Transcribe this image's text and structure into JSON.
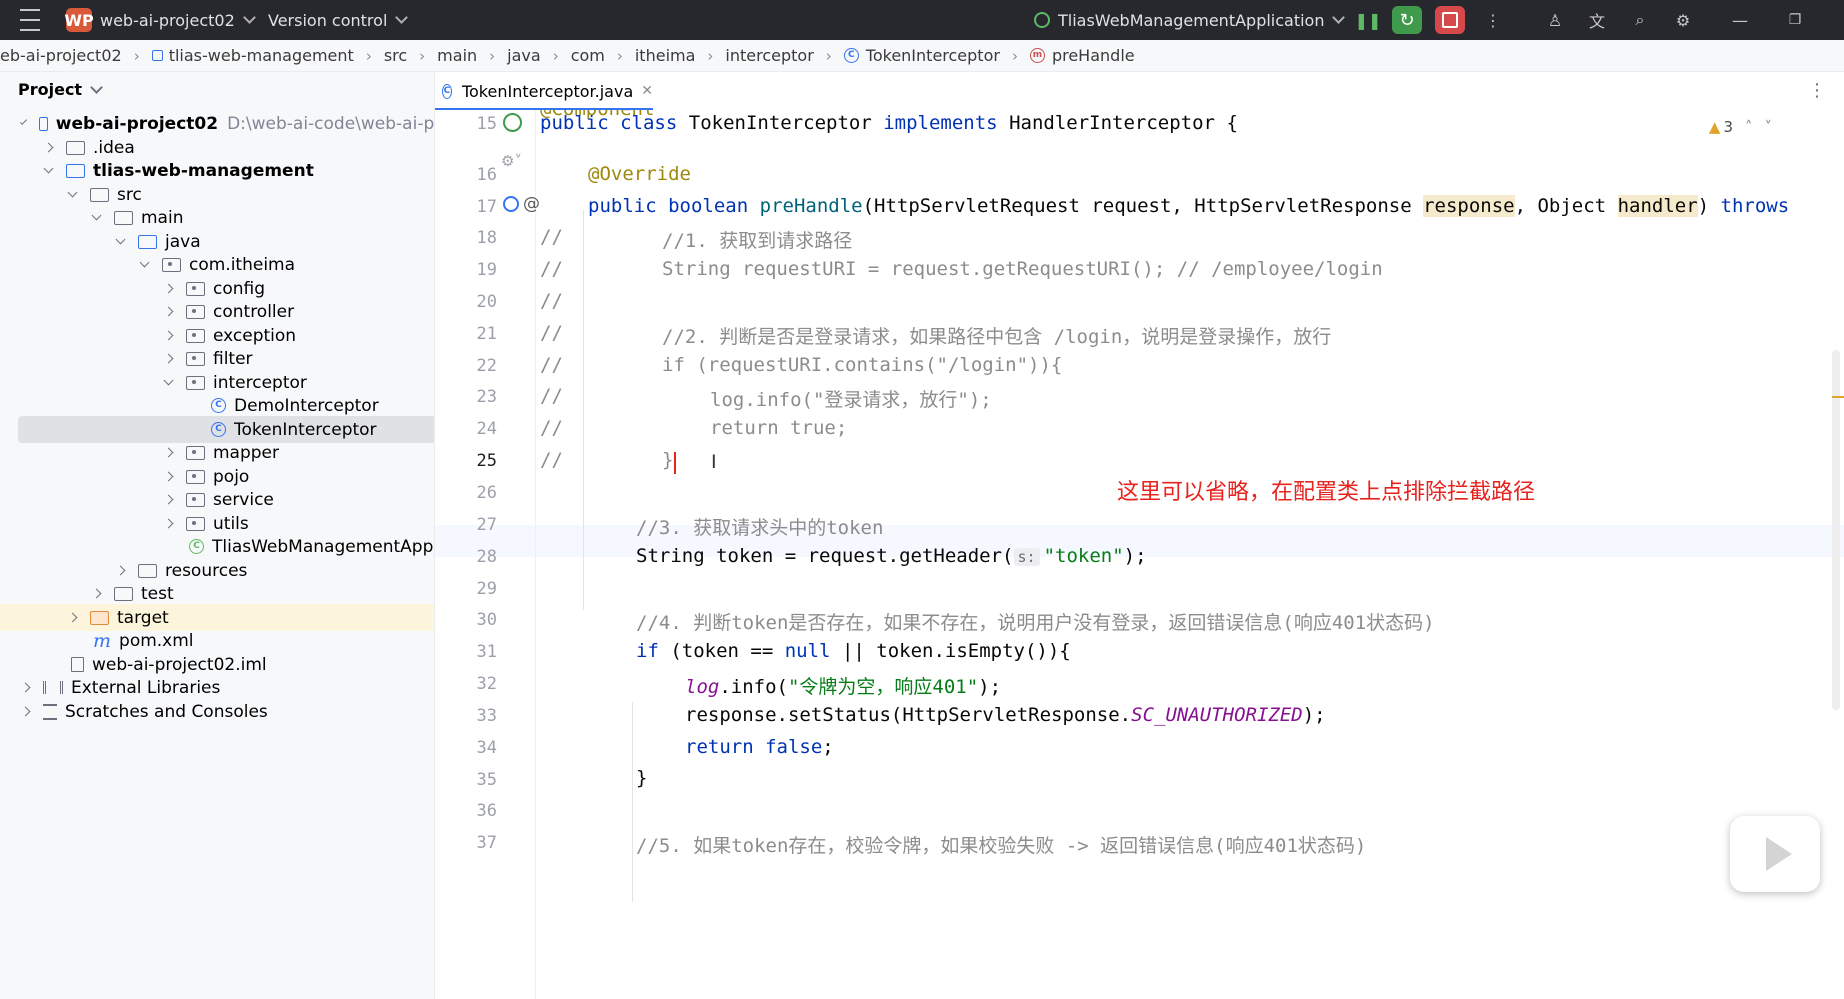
{
  "titlebar": {
    "project_badge": "WP",
    "project_name": "web-ai-project02",
    "vcs_label": "Version control",
    "run_config": "TliasWebManagementApplication"
  },
  "breadcrumb": [
    "eb-ai-project02",
    "tlias-web-management",
    "src",
    "main",
    "java",
    "com",
    "itheima",
    "interceptor",
    "TokenInterceptor",
    "preHandle"
  ],
  "project_panel": {
    "title": "Project",
    "tree": [
      {
        "label": "web-ai-project02",
        "extra": "D:\\web-ai-code\\web-ai-proj"
      },
      {
        "label": ".idea"
      },
      {
        "label": "tlias-web-management"
      },
      {
        "label": "src"
      },
      {
        "label": "main"
      },
      {
        "label": "java"
      },
      {
        "label": "com.itheima"
      },
      {
        "label": "config"
      },
      {
        "label": "controller"
      },
      {
        "label": "exception"
      },
      {
        "label": "filter"
      },
      {
        "label": "interceptor"
      },
      {
        "label": "DemoInterceptor"
      },
      {
        "label": "TokenInterceptor"
      },
      {
        "label": "mapper"
      },
      {
        "label": "pojo"
      },
      {
        "label": "service"
      },
      {
        "label": "utils"
      },
      {
        "label": "TliasWebManagementApplica"
      },
      {
        "label": "resources"
      },
      {
        "label": "test"
      },
      {
        "label": "target"
      },
      {
        "label": "pom.xml"
      },
      {
        "label": "web-ai-project02.iml"
      },
      {
        "label": "External Libraries"
      },
      {
        "label": "Scratches and Consoles"
      }
    ]
  },
  "editor": {
    "tab_label": "TokenInterceptor.java",
    "warning_count": "3",
    "top_fragment": "@Component",
    "line_numbers": [
      "15",
      "16",
      "17",
      "18",
      "19",
      "20",
      "21",
      "22",
      "23",
      "24",
      "25",
      "26",
      "27",
      "28",
      "29",
      "30",
      "31",
      "32",
      "33",
      "34",
      "35",
      "36",
      "37"
    ],
    "code": {
      "l15": [
        "public",
        "class",
        "TokenInterceptor",
        "implements",
        "HandlerInterceptor",
        "{"
      ],
      "l16": "@Override",
      "l17": [
        "public",
        "boolean",
        "preHandle",
        "(HttpServletRequest request, HttpServletResponse ",
        "response",
        ", Object ",
        "handler",
        ") ",
        "throws"
      ],
      "l18": [
        "//",
        "//1. 获取到请求路径"
      ],
      "l19": [
        "//",
        "String requestURI = request.getRequestURI(); // /employee/login"
      ],
      "l20": "//",
      "l21": [
        "//",
        "//2. 判断是否是登录请求，如果路径中包含 /login，说明是登录操作，放行"
      ],
      "l22": [
        "//",
        "if (requestURI.contains(\"/login\")){"
      ],
      "l23": [
        "//",
        "log.info(\"登录请求，放行\");"
      ],
      "l24": [
        "//",
        "return true;"
      ],
      "l25": [
        "//",
        "}"
      ],
      "l27": "//3. 获取请求头中的token",
      "l28": [
        "String token = request.getHeader(",
        "s:",
        "\"token\"",
        ");"
      ],
      "l30": "//4. 判断token是否存在，如果不存在，说明用户没有登录，返回错误信息(响应401状态码)",
      "l31": [
        "if",
        " (token == ",
        "null",
        " || token.isEmpty()){"
      ],
      "l32": [
        "log",
        ".info(",
        "\"令牌为空，响应401\"",
        ");"
      ],
      "l33": [
        "response.setStatus(HttpServletResponse.",
        "SC_UNAUTHORIZED",
        ");"
      ],
      "l34": [
        "return",
        " false",
        ";"
      ],
      "l35": "}",
      "l37": "//5. 如果token存在，校验令牌，如果校验失败 -> 返回错误信息(响应401状态码)"
    }
  },
  "annotation": "这里可以省略，在配置类上点排除拦截路径",
  "colors": {
    "accent": "#3574f0",
    "annotation": "#e8221c",
    "titlebar": "#27282e"
  }
}
